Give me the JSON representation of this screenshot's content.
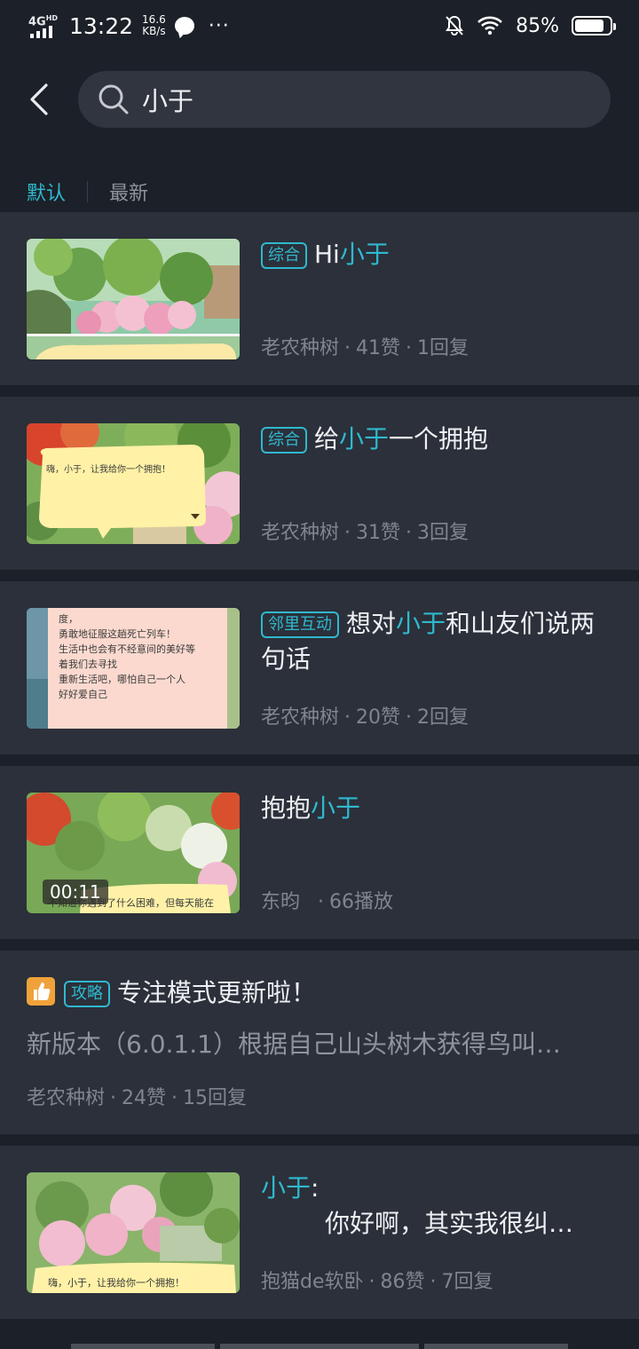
{
  "status_bar": {
    "network": "4G",
    "network_sup": "HD",
    "time": "13:22",
    "speed_value": "16.6",
    "speed_unit": "KB/s",
    "more": "···",
    "battery": "85%",
    "battery_level": 0.85
  },
  "search": {
    "query": "小于"
  },
  "sort_tabs": {
    "default": "默认",
    "latest": "最新"
  },
  "posts": [
    {
      "tag": "综合",
      "title_before": "Hi",
      "title_highlight": "小于",
      "title_after": "",
      "author": "老农种树",
      "likes": "41赞",
      "replies": "1回复"
    },
    {
      "tag": "综合",
      "title_before": "给",
      "title_highlight": "小于",
      "title_after": "一个拥抱",
      "author": "老农种树",
      "likes": "31赞",
      "replies": "3回复",
      "thumb_text": "嗨，小于，让我给你一个拥抱！"
    },
    {
      "tag": "邻里互动",
      "title_before": "想对",
      "title_highlight": "小于",
      "title_after": "和山友们说两句话",
      "author": "老农种树",
      "likes": "20赞",
      "replies": "2回复",
      "thumb_lines": [
        "度，",
        "勇敢地征服这趟死亡列车！",
        "生活中也会有不经意间的美好等",
        "着我们去寻找",
        "重新生活吧，哪怕自己一个人",
        "好好爱自己"
      ]
    },
    {
      "title_before": "抱抱",
      "title_highlight": "小于",
      "author": "东昀",
      "plays": "66播放",
      "duration": "00:11",
      "thumb_text": "不知道你遇到了什么困难，但每天能在"
    },
    {
      "tag": "攻略",
      "title": "专注模式更新啦！",
      "summary": "新版本（6.0.1.1）根据自己山头树木获得鸟叫…",
      "author": "老农种树",
      "likes": "24赞",
      "replies": "15回复"
    },
    {
      "title_highlight": "小于",
      "title_after": ":",
      "title_line2": "你好啊，其实我很纠…",
      "author": "抱猫de软卧",
      "likes": "86赞",
      "replies": "7回复",
      "thumb_text": "嗨，小于，让我给你一个拥抱！"
    }
  ],
  "colors": {
    "accent": "#2fb9cf",
    "background": "#1c2028",
    "card": "#2b303a"
  }
}
